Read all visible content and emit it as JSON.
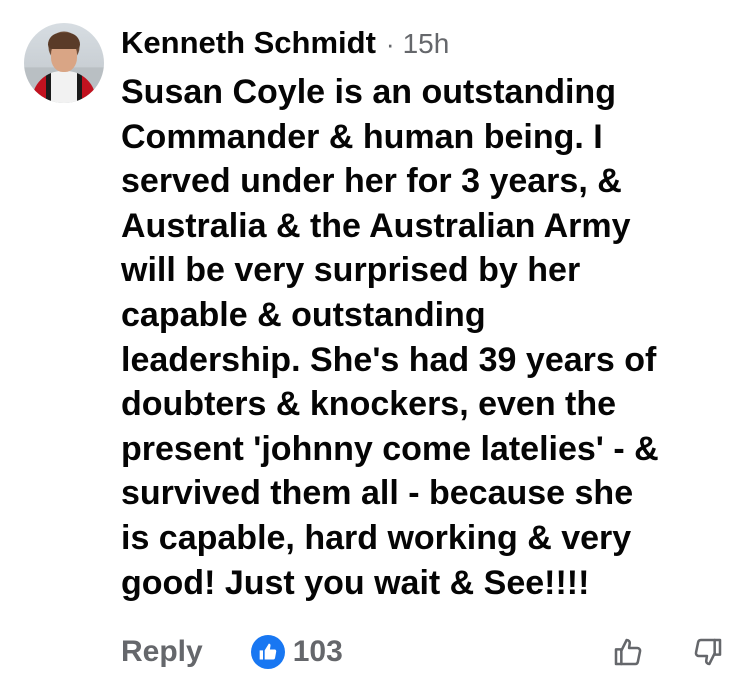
{
  "comment": {
    "author": "Kenneth Schmidt",
    "separator": "·",
    "time": "15h",
    "lines": [
      "Susan Coyle is an outstanding",
      "Commander & human being. I",
      "served under her for 3 years, &",
      "Australia & the Australian Army",
      "will be very surprised by her",
      "capable & outstanding",
      "leadership. She's had 39 years of",
      "doubters & knockers, even the",
      "present 'johnny come latelies' - &",
      "survived them all - because she",
      "is capable, hard working & very",
      "good! Just you wait & See!!!!"
    ]
  },
  "actions": {
    "reply_label": "Reply",
    "reaction_count": "103",
    "reaction_icon": "like-icon",
    "like_icon": "thumbs-up-icon",
    "dislike_icon": "thumbs-down-icon"
  },
  "colors": {
    "text": "#050505",
    "secondary": "#65676b",
    "like_blue": "#1877f2"
  }
}
